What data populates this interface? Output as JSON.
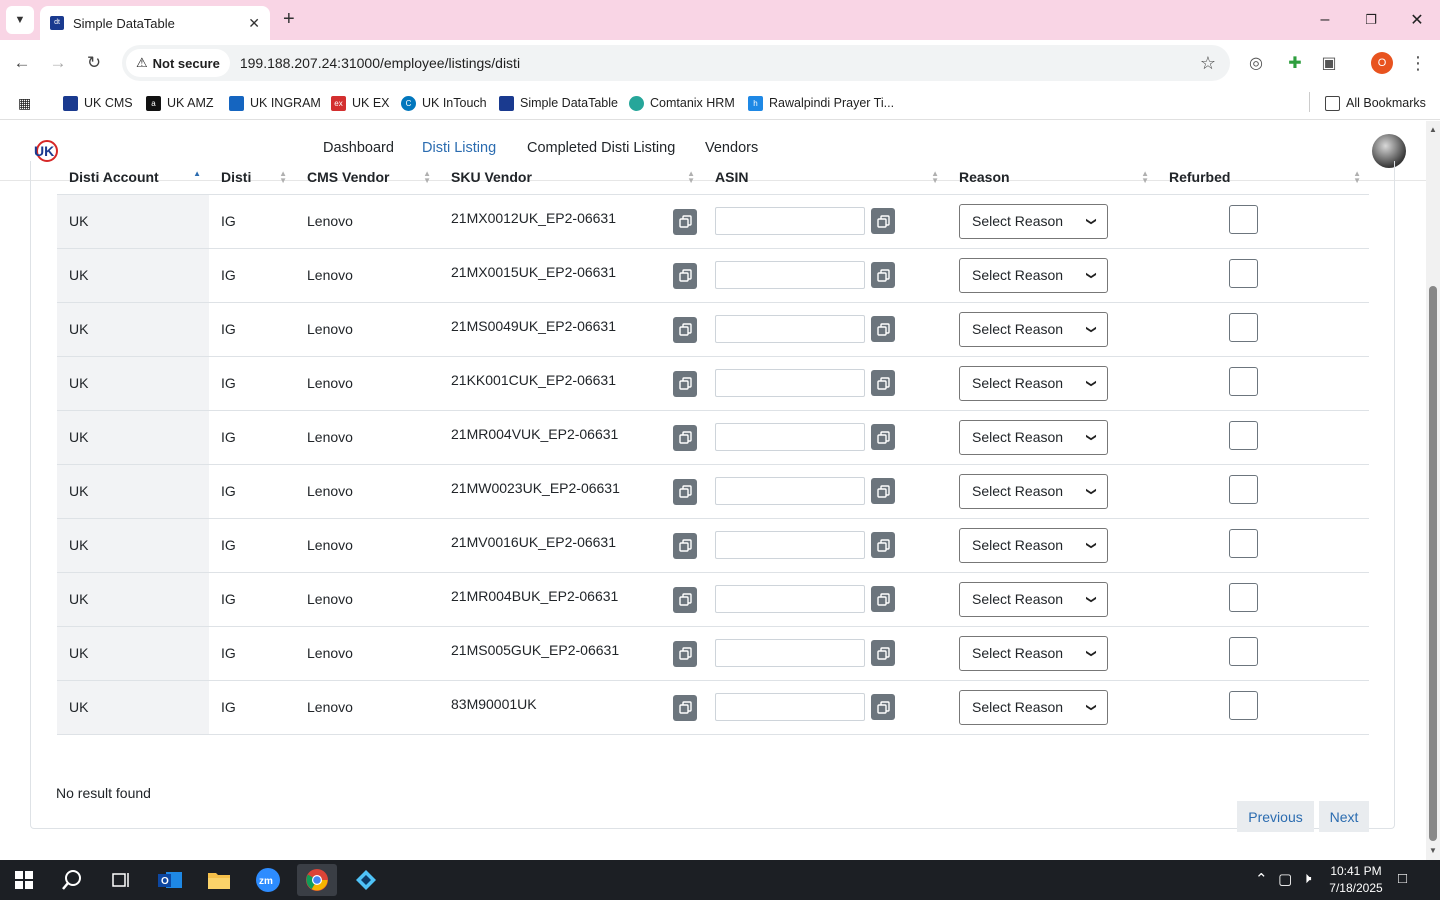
{
  "browser": {
    "tab_title": "Simple DataTable",
    "security_label": "Not secure",
    "url": "199.188.207.24:31000/employee/listings/disti",
    "profile_initial": "O",
    "bookmarks": [
      {
        "label": "UK CMS",
        "color": "#1a3a8f"
      },
      {
        "label": "UK AMZ",
        "color": "#111111"
      },
      {
        "label": "UK INGRAM",
        "color": "#1565c0"
      },
      {
        "label": "UK EX",
        "color": "#d32f2f"
      },
      {
        "label": "UK InTouch",
        "color": "#0277bd"
      },
      {
        "label": "Simple DataTable",
        "color": "#1a3a8f"
      },
      {
        "label": "Comtanix HRM",
        "color": "#26a69a"
      },
      {
        "label": "Rawalpindi Prayer Ti...",
        "color": "#1e88e5"
      }
    ],
    "all_bookmarks": "All Bookmarks"
  },
  "nav": {
    "links": [
      "Dashboard",
      "Disti Listing",
      "Completed Disti Listing",
      "Vendors"
    ],
    "active": "Disti Listing"
  },
  "table": {
    "columns": [
      "Disti Account",
      "Disti",
      "CMS Vendor",
      "SKU Vendor",
      "ASIN",
      "Reason",
      "Refurbed"
    ],
    "rows": [
      {
        "account": "UK",
        "disti": "IG",
        "vendor": "Lenovo",
        "sku": "21MX0012UK_EP2-06631",
        "asin": "",
        "reason": "Select Reason",
        "refurbed": false
      },
      {
        "account": "UK",
        "disti": "IG",
        "vendor": "Lenovo",
        "sku": "21MX0015UK_EP2-06631",
        "asin": "",
        "reason": "Select Reason",
        "refurbed": false
      },
      {
        "account": "UK",
        "disti": "IG",
        "vendor": "Lenovo",
        "sku": "21MS0049UK_EP2-06631",
        "asin": "",
        "reason": "Select Reason",
        "refurbed": false
      },
      {
        "account": "UK",
        "disti": "IG",
        "vendor": "Lenovo",
        "sku": "21KK001CUK_EP2-06631",
        "asin": "",
        "reason": "Select Reason",
        "refurbed": false
      },
      {
        "account": "UK",
        "disti": "IG",
        "vendor": "Lenovo",
        "sku": "21MR004VUK_EP2-06631",
        "asin": "",
        "reason": "Select Reason",
        "refurbed": false
      },
      {
        "account": "UK",
        "disti": "IG",
        "vendor": "Lenovo",
        "sku": "21MW0023UK_EP2-06631",
        "asin": "",
        "reason": "Select Reason",
        "refurbed": false
      },
      {
        "account": "UK",
        "disti": "IG",
        "vendor": "Lenovo",
        "sku": "21MV0016UK_EP2-06631",
        "asin": "",
        "reason": "Select Reason",
        "refurbed": false
      },
      {
        "account": "UK",
        "disti": "IG",
        "vendor": "Lenovo",
        "sku": "21MR004BUK_EP2-06631",
        "asin": "",
        "reason": "Select Reason",
        "refurbed": false
      },
      {
        "account": "UK",
        "disti": "IG",
        "vendor": "Lenovo",
        "sku": "21MS005GUK_EP2-06631",
        "asin": "",
        "reason": "Select Reason",
        "refurbed": false
      },
      {
        "account": "UK",
        "disti": "IG",
        "vendor": "Lenovo",
        "sku": "83M90001UK",
        "asin": "",
        "reason": "Select Reason",
        "refurbed": false
      }
    ]
  },
  "footer": {
    "no_result": "No result found",
    "previous": "Previous",
    "next": "Next"
  },
  "taskbar": {
    "time": "10:41 PM",
    "date": "7/18/2025"
  },
  "colors": {
    "link_active": "#2b6cb0",
    "copy_button": "#6c757d",
    "tab_strip": "#f9d5e5"
  }
}
